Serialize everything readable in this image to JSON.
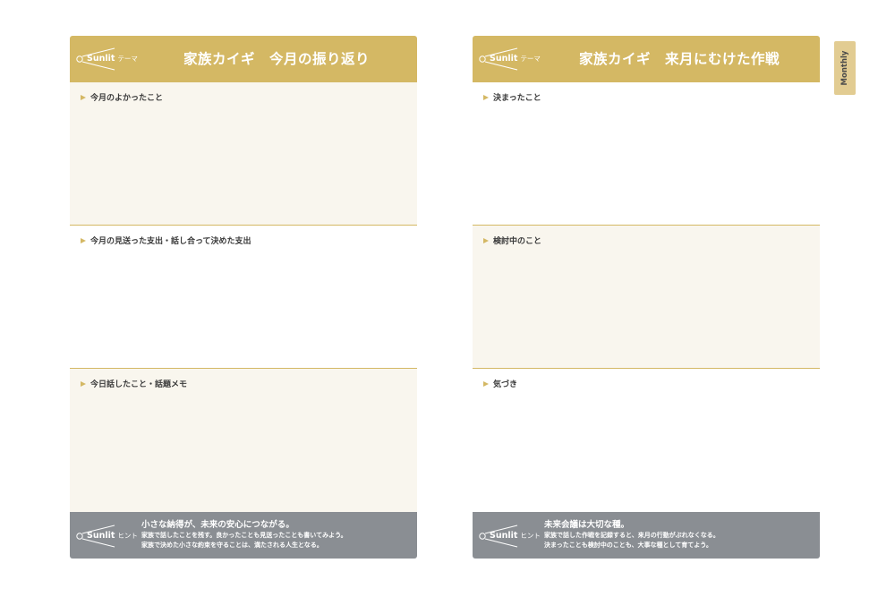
{
  "left_page": {
    "logo": {
      "brand": "Sunlit",
      "sub": "テーマ"
    },
    "title": "家族カイギ　今月の振り返り",
    "sections": [
      {
        "label": "今月のよかったこと"
      },
      {
        "label": "今月の見送った支出・話し合って決めた支出"
      },
      {
        "label": "今日話したこと・話題メモ"
      }
    ],
    "footer": {
      "logo": {
        "brand": "Sunlit",
        "sub": "ヒント"
      },
      "headline": "小さな納得が、未来の安心につながる。",
      "lines": [
        "家族で話したことを残す。良かったことも見送ったことも書いてみよう。",
        "家族で決めた小さな約束を守ることは、満たされる人生となる。"
      ]
    }
  },
  "right_page": {
    "logo": {
      "brand": "Sunlit",
      "sub": "テーマ"
    },
    "title": "家族カイギ　来月にむけた作戦",
    "sections": [
      {
        "label": "決まったこと"
      },
      {
        "label": "検討中のこと"
      },
      {
        "label": "気づき"
      }
    ],
    "footer": {
      "logo": {
        "brand": "Sunlit",
        "sub": "ヒント"
      },
      "headline": "未来会議は大切な種。",
      "lines": [
        "家族で話した作戦を記録すると、来月の行動がぶれなくなる。",
        "決まったことも検討中のことも、大事な種として育てよう。"
      ]
    }
  },
  "side_tab": {
    "label": "Monthly"
  },
  "colors": {
    "header": "#d4b864",
    "cream": "#f9f6ee",
    "footer": "#8a8e93",
    "tab": "#e2cc92"
  }
}
